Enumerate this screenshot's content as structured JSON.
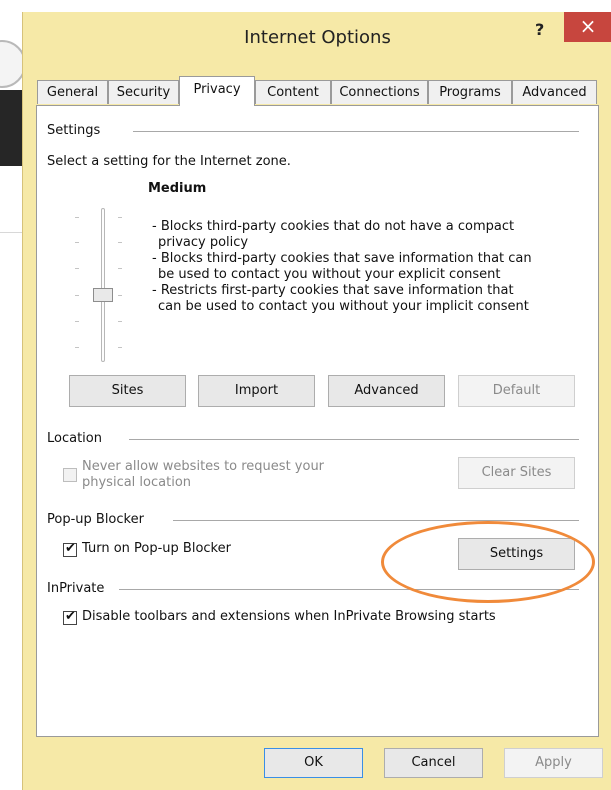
{
  "window": {
    "title": "Internet Options",
    "help_glyph": "?",
    "close_glyph": "×"
  },
  "tabs": [
    {
      "label": "General"
    },
    {
      "label": "Security"
    },
    {
      "label": "Privacy",
      "active": true
    },
    {
      "label": "Content"
    },
    {
      "label": "Connections"
    },
    {
      "label": "Programs"
    },
    {
      "label": "Advanced"
    }
  ],
  "settings": {
    "group_label": "Settings",
    "instruction": "Select a setting for the Internet zone.",
    "level": "Medium",
    "description": [
      "- Blocks third-party cookies that do not have a compact",
      "privacy policy",
      "- Blocks third-party cookies that save information that can",
      "be used to contact you without your explicit consent",
      "- Restricts first-party cookies that save information that",
      "can be used to contact you without your implicit consent"
    ],
    "buttons": {
      "sites": "Sites",
      "import": "Import",
      "advanced": "Advanced",
      "default": "Default"
    }
  },
  "location": {
    "group_label": "Location",
    "checkbox_label": "Never allow websites to request your physical location",
    "checkbox_line1": "Never allow websites to request your",
    "checkbox_line2": "physical location",
    "clear_sites": "Clear Sites"
  },
  "popup": {
    "group_label": "Pop-up Blocker",
    "checkbox_label": "Turn on Pop-up Blocker",
    "settings_button": "Settings"
  },
  "inprivate": {
    "group_label": "InPrivate",
    "checkbox_label": "Disable toolbars and extensions when InPrivate Browsing starts"
  },
  "footer": {
    "ok": "OK",
    "cancel": "Cancel",
    "apply": "Apply"
  },
  "colors": {
    "titlebar": "#f6e9a7",
    "close": "#c7463e",
    "highlight": "#f08a3a"
  }
}
